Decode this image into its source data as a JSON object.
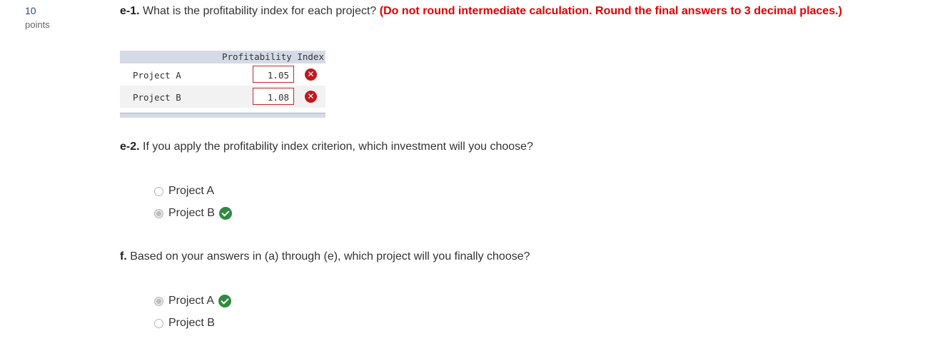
{
  "points": {
    "value": "10",
    "label": "points"
  },
  "e1": {
    "number": "e-1.",
    "question": "What is the profitability index for each project?",
    "instruction": "(Do not round intermediate calculation. Round the final answers to 3 decimal places.)",
    "table": {
      "header": "Profitability Index",
      "rows": [
        {
          "label": "Project A",
          "value": "1.05",
          "status": "incorrect"
        },
        {
          "label": "Project B",
          "value": "1.08",
          "status": "incorrect"
        }
      ]
    }
  },
  "e2": {
    "number": "e-2.",
    "question": "If you apply the profitability index criterion, which investment will you choose?",
    "options": [
      {
        "label": "Project A",
        "selected": false
      },
      {
        "label": "Project B",
        "selected": true,
        "status": "correct"
      }
    ]
  },
  "f": {
    "number": "f.",
    "question": "Based on your answers in (a) through (e), which project will you finally choose?",
    "options": [
      {
        "label": "Project A",
        "selected": true,
        "status": "correct"
      },
      {
        "label": "Project B",
        "selected": false
      }
    ]
  },
  "colors": {
    "instruction_red": "#e00000",
    "incorrect_red": "#c4161c",
    "correct_green": "#2f8a3f",
    "table_header_bg": "#d5dbe6",
    "points_blue": "#2a4a7c"
  },
  "icons": {
    "incorrect": "x-circle-icon",
    "correct": "check-circle-icon"
  }
}
